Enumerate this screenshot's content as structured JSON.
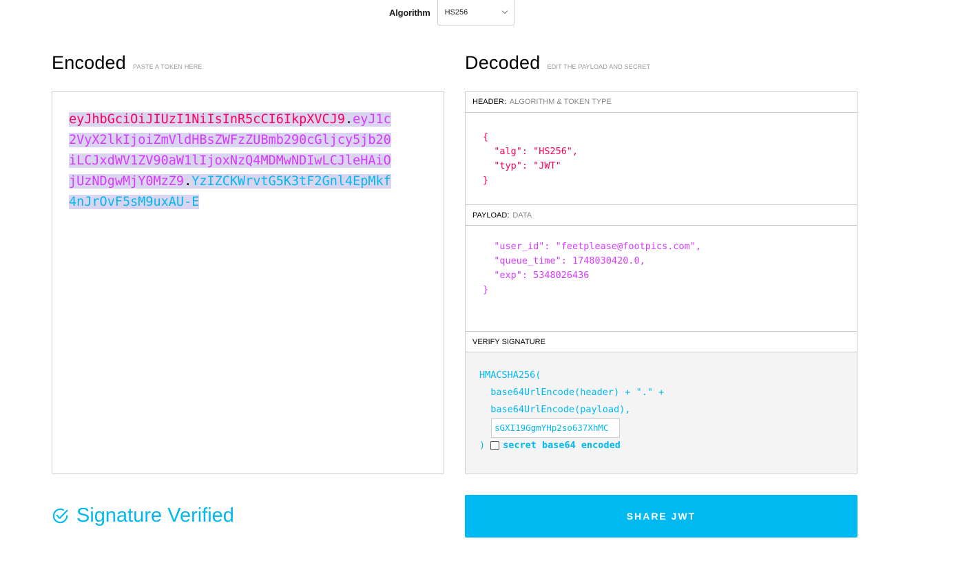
{
  "algorithm": {
    "label": "Algorithm",
    "selected": "HS256"
  },
  "encoded": {
    "title": "Encoded",
    "subtitle": "PASTE A TOKEN HERE",
    "token_header": "eyJhbGciOiJIUzI1NiIsInR5cCI6IkpXVCJ9",
    "token_payload": "eyJ1c2VyX2lkIjoiZmVldHBsZWFzZUBmb290cGljcy5jb20iLCJxdWV1ZV90aW1lIjoxNzQ4MDMwNDIwLCJleHAiOjUzNDgwMjY0MzZ9",
    "token_signature": "YzIZCKWrvtG5K3tF2Gnl4EpMkf4nJrOvF5sM9uxAU-E",
    "dot": "."
  },
  "decoded": {
    "title": "Decoded",
    "subtitle": "EDIT THE PAYLOAD AND SECRET",
    "header_label": "HEADER:",
    "header_muted": "ALGORITHM & TOKEN TYPE",
    "header_json": "{\n  \"alg\": \"HS256\",\n  \"typ\": \"JWT\"\n}",
    "payload_label": "PAYLOAD:",
    "payload_muted": "DATA",
    "payload_json": "  \"user_id\": \"feetplease@footpics.com\",\n  \"queue_time\": 1748030420.0,\n  \"exp\": 5348026436\n}",
    "verify_label": "VERIFY SIGNATURE",
    "verify_fn": "HMACSHA256(",
    "verify_line1": "  base64UrlEncode(header) + \".\" +",
    "verify_line2": "  base64UrlEncode(payload),",
    "secret_value": "sGXI19GgmYHp2so637XhMC",
    "closing_paren": ")",
    "secret_checkbox_label": "secret base64 encoded"
  },
  "status": {
    "verified_text": "Signature Verified"
  },
  "share_button": "SHARE JWT",
  "colors": {
    "header": "#fb015b",
    "payload": "#d63aff",
    "signature": "#00b9f1"
  }
}
